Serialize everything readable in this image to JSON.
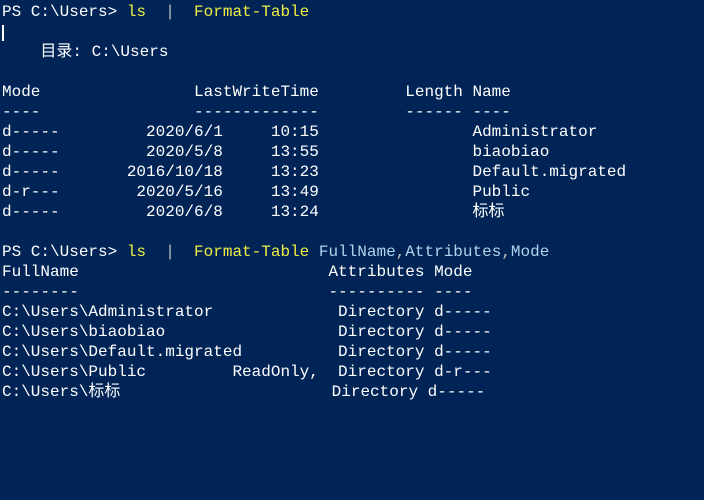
{
  "prompt1": {
    "ps": "PS C:\\Users>",
    "cmd": "ls",
    "pipe": "|",
    "format": "Format-Table"
  },
  "blank1": "",
  "dir_header": "    目录: C:\\Users",
  "blank2": "",
  "table1": {
    "header": "Mode                LastWriteTime         Length Name",
    "divider": "----                -------------         ------ ----",
    "rows": [
      "d-----         2020/6/1     10:15                Administrator",
      "d-----         2020/5/8     13:55                biaobiao",
      "d-----       2016/10/18     13:23                Default.migrated",
      "d-r---        2020/5/16     13:49                Public",
      "d-----         2020/6/8     13:24                标标"
    ]
  },
  "blank3": "",
  "prompt2": {
    "ps": "PS C:\\Users>",
    "cmd": "ls",
    "pipe": "|",
    "format": "Format-Table",
    "args": "FullName",
    "comma1": ",",
    "args2": "Attributes",
    "comma2": ",",
    "args3": "Mode"
  },
  "blank4": "",
  "table2": {
    "header": "FullName                          Attributes Mode",
    "divider": "--------                          ---------- ----",
    "rows": [
      "C:\\Users\\Administrator             Directory d-----",
      "C:\\Users\\biaobiao                  Directory d-----",
      "C:\\Users\\Default.migrated          Directory d-----",
      "C:\\Users\\Public         ReadOnly,  Directory d-r---",
      "C:\\Users\\标标                      Directory d-----"
    ]
  }
}
